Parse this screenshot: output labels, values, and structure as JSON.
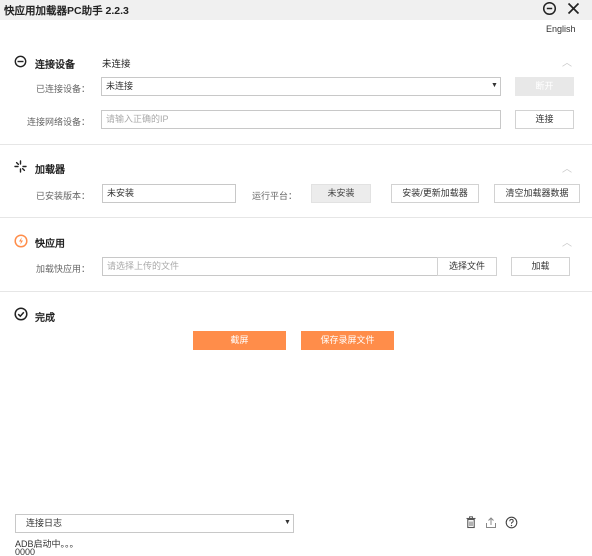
{
  "window": {
    "title": "快应用加载器PC助手 2.2.3",
    "language_link": "English"
  },
  "connect_section": {
    "title": "连接设备",
    "status": "未连接",
    "connected_device_label": "已连接设备：",
    "connected_device_value": "未连接",
    "disconnect_button": "断开",
    "network_device_label": "连接网络设备：",
    "ip_placeholder": "请输入正确的IP",
    "connect_button": "连接"
  },
  "loader_section": {
    "title": "加载器",
    "installed_version_label": "已安装版本：",
    "installed_version_value": "未安装",
    "platform_label": "运行平台：",
    "platform_value": "未安装",
    "install_update_button": "安装/更新加载器",
    "clear_data_button": "清空加载器数据"
  },
  "quickapp_section": {
    "title": "快应用",
    "load_label": "加载快应用：",
    "file_placeholder": "请选择上传的文件",
    "choose_file_button": "选择文件",
    "load_button": "加载"
  },
  "done_section": {
    "title": "完成",
    "screenshot_button": "截屏",
    "save_recording_button": "保存录屏文件"
  },
  "log_panel": {
    "select_value": "连接日志",
    "lines": [
      "ADB启动中。。。",
      "0000"
    ]
  },
  "colors": {
    "accent_orange": "#ff8d4a",
    "disabled_gray": "#e8e8e8",
    "titlebar_bg": "#f0f0f0"
  },
  "icons": [
    "minimize-icon",
    "close-icon",
    "connect-icon",
    "loader-icon",
    "quickapp-icon",
    "check-circle-icon",
    "trash-icon",
    "upload-icon",
    "help-icon"
  ]
}
